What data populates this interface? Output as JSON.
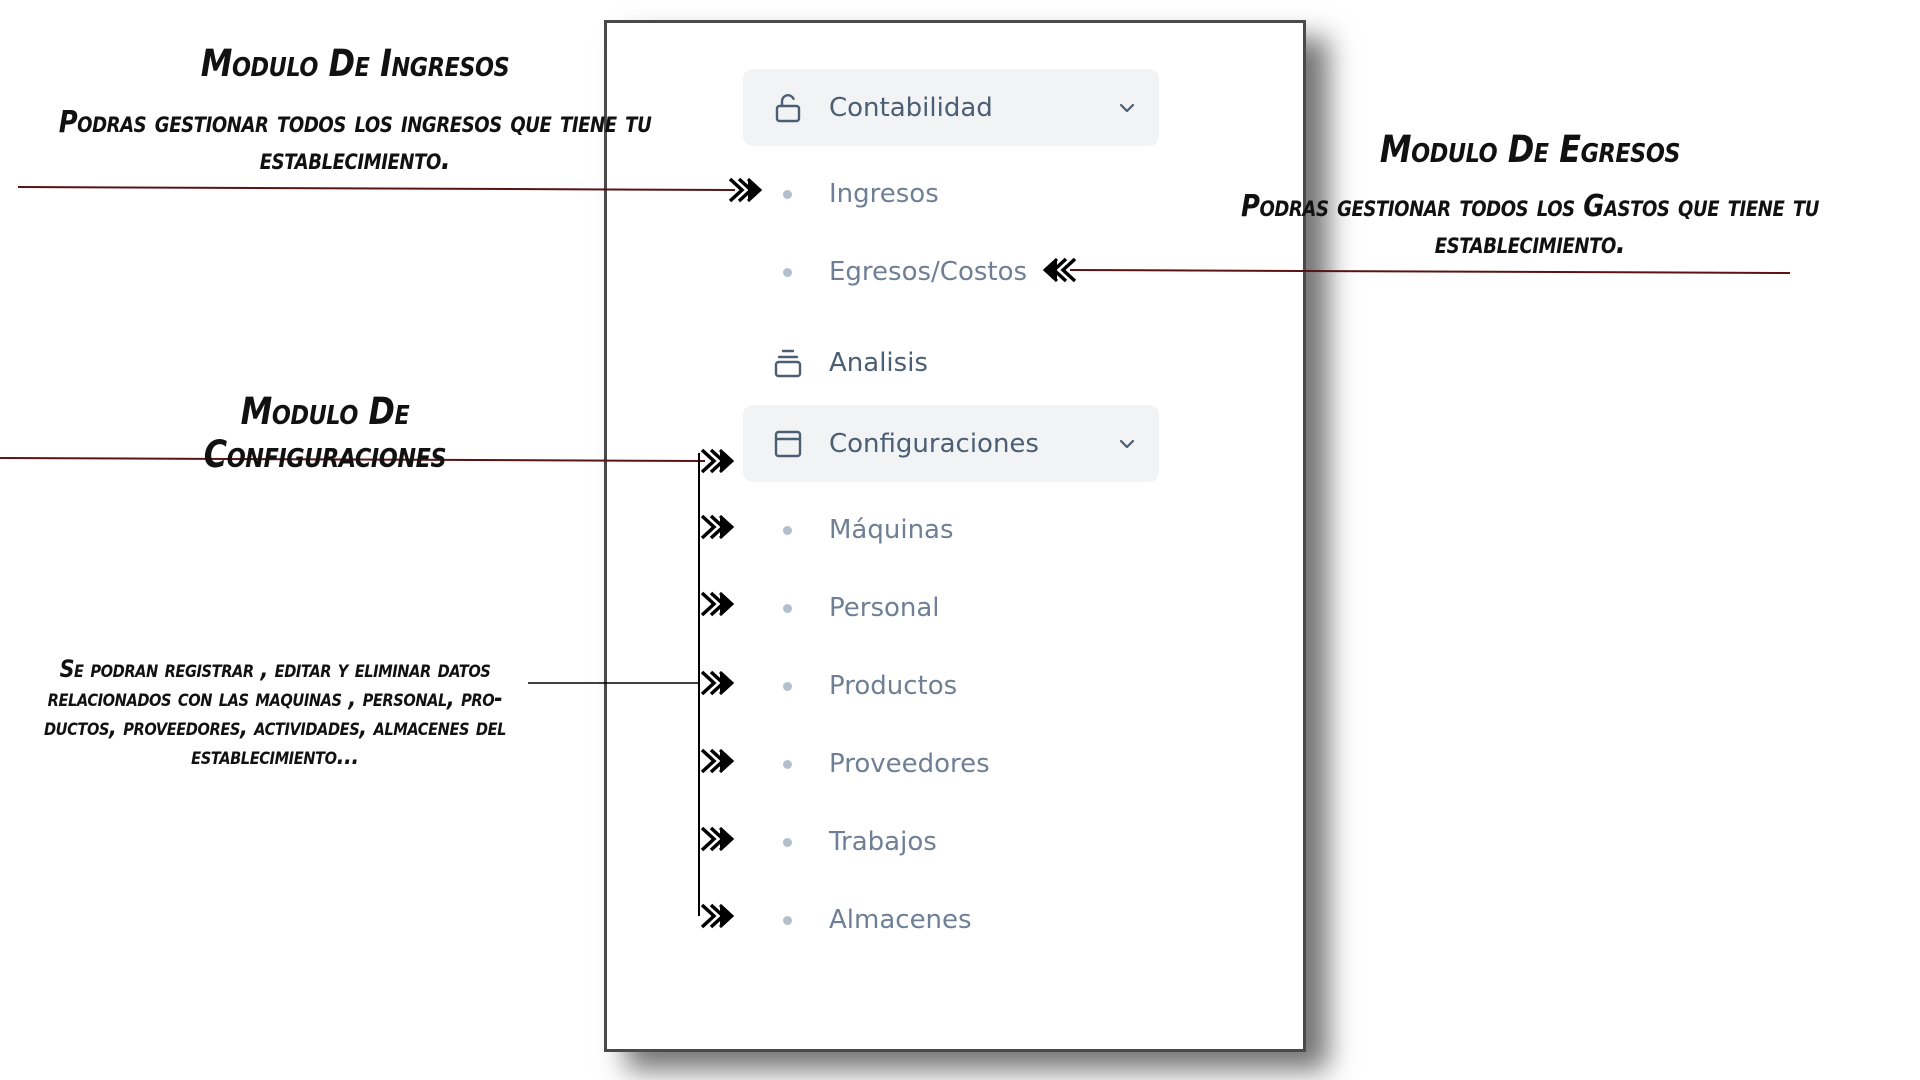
{
  "menu": {
    "contabilidad": {
      "label": "Contabilidad",
      "icon": "unlock-icon",
      "items": [
        {
          "label": "Ingresos"
        },
        {
          "label": "Egresos/Costos"
        }
      ]
    },
    "analisis": {
      "label": "Analisis",
      "icon": "layers-icon"
    },
    "configuraciones": {
      "label": "Configuraciones",
      "icon": "calendar-icon",
      "items": [
        {
          "label": "Máquinas"
        },
        {
          "label": "Personal"
        },
        {
          "label": "Productos"
        },
        {
          "label": "Proveedores"
        },
        {
          "label": "Trabajos"
        },
        {
          "label": "Almacenes"
        }
      ]
    }
  },
  "annotations": {
    "ingresos": {
      "title": "Modulo De Ingresos",
      "line1": "Podras gestionar todos los ingresos que tiene tu",
      "line2": "establecimiento."
    },
    "egresos": {
      "title": "Modulo De Egresos",
      "line1": "Podras gestionar todos los Gastos que tiene tu",
      "line2": "establecimiento."
    },
    "configuraciones": {
      "title": "Modulo De Configuraciones"
    },
    "datos": {
      "line1": "Se podran registrar , editar y eliminar datos",
      "line2": "relacionados con las maquinas , personal, pro-",
      "line3": "ductos, proveedores, actividades, almacenes del",
      "line4": "establecimiento..."
    }
  },
  "colors": {
    "menu_bg": "#f1f3f5",
    "text_main": "#4b5e74",
    "text_sub": "#6f8096",
    "arrow_line": "#5a1414"
  }
}
